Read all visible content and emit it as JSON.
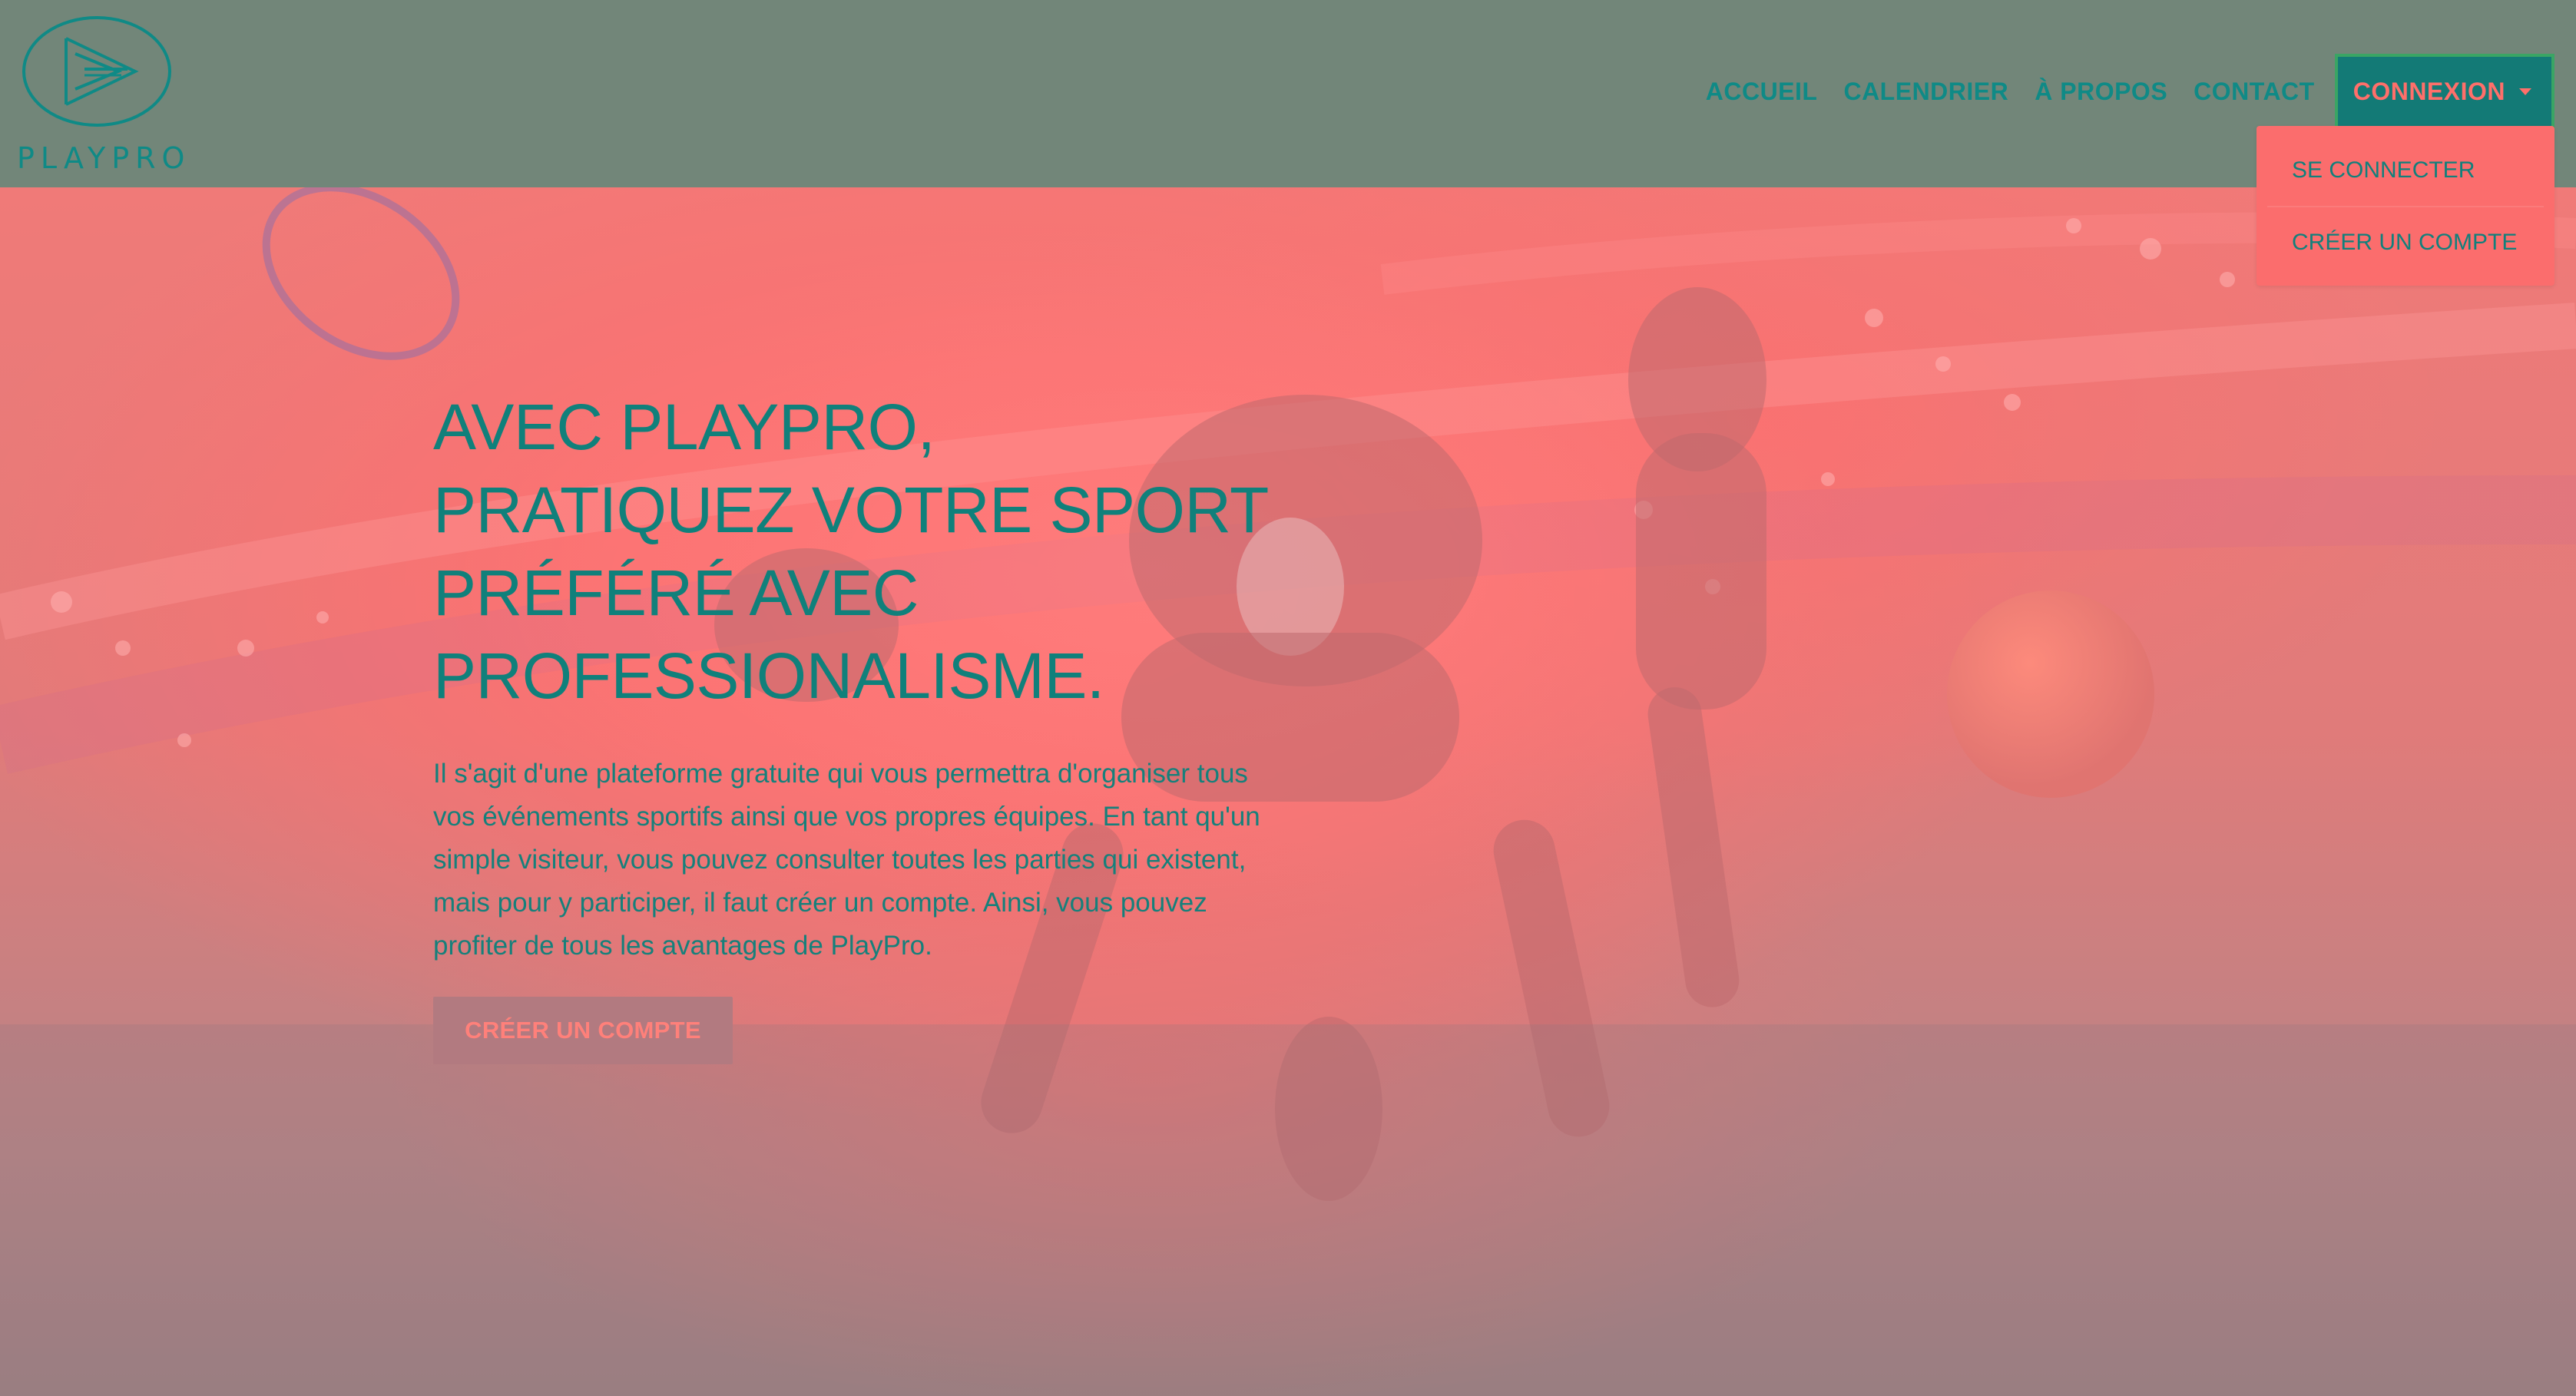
{
  "brand": {
    "name": "PLAYPRO",
    "logo_icon": "play-triangle-logo-icon"
  },
  "nav": {
    "items": [
      {
        "label": "ACCUEIL"
      },
      {
        "label": "CALENDRIER"
      },
      {
        "label": "À PROPOS"
      },
      {
        "label": "CONTACT"
      }
    ],
    "dropdown_toggle": {
      "label": "CONNEXION",
      "icon": "caret-down-icon"
    }
  },
  "dropdown": {
    "items": [
      {
        "label": "SE CONNECTER"
      },
      {
        "label": "CRÉER UN COMPTE"
      }
    ]
  },
  "hero": {
    "headline_lines": [
      "AVEC PLAYPRO,",
      "PRATIQUEZ VOTRE SPORT",
      "PRÉFÉRÉ AVEC",
      "PROFESSIONALISME."
    ],
    "description": "Il s'agit d'une plateforme gratuite qui vous permettra d'organiser tous vos événements sportifs ainsi que vos propres équipes. En tant qu'un simple visiteur, vous pouvez consulter toutes les parties qui existent, mais pour y participer, il faut créer un compte. Ainsi, vous pouvez profiter de tous les avantages de PlayPro.",
    "cta_label": "CRÉER UN COMPTE",
    "background_image": "sports-collage-image"
  },
  "colors": {
    "navbar_bg": "#728679",
    "accent_teal": "#10807b",
    "coral": "#fb6d6d",
    "toggle_bg": "#137a76",
    "toggle_border": "#3aa564",
    "cta_bg": "#b27a80"
  }
}
